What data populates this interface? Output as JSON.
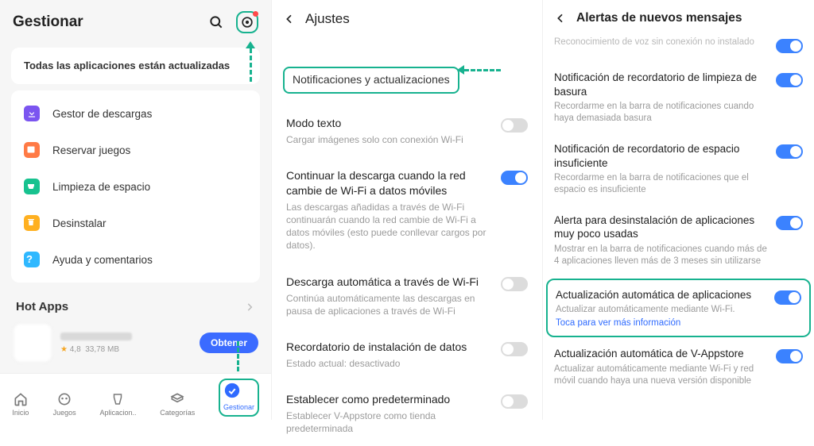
{
  "colors": {
    "accent": "#3b6bff",
    "outline": "#17b28f"
  },
  "paneA": {
    "title": "Gestionar",
    "update_card": "Todas las aplicaciones están actualizadas",
    "menu": [
      {
        "icon": "download",
        "color": "#7b55f0",
        "label": "Gestor de descargas"
      },
      {
        "icon": "calendar",
        "color": "#ff7a45",
        "label": "Reservar juegos"
      },
      {
        "icon": "broom",
        "color": "#17c28f",
        "label": "Limpieza de espacio"
      },
      {
        "icon": "trash",
        "color": "#ffb020",
        "label": "Desinstalar"
      },
      {
        "icon": "help",
        "color": "#2fb8ff",
        "label": "Ayuda y comentarios"
      }
    ],
    "hotapps_title": "Hot Apps",
    "app": {
      "rating": "4,8",
      "size": "33,78 MB",
      "get": "Obtener"
    },
    "nav": [
      {
        "icon": "home",
        "label": "Inicio"
      },
      {
        "icon": "games",
        "label": "Juegos"
      },
      {
        "icon": "apps",
        "label": "Aplicacion.."
      },
      {
        "icon": "cats",
        "label": "Categorías"
      },
      {
        "icon": "manage",
        "label": "Gestionar"
      }
    ]
  },
  "paneB": {
    "title": "Ajustes",
    "section_link": "Notificaciones y actualizaciones",
    "items": [
      {
        "title": "Modo texto",
        "sub": "Cargar imágenes solo con conexión Wi-Fi",
        "on": false
      },
      {
        "title": "Continuar la descarga cuando la red cambie de Wi-Fi a datos móviles",
        "sub": "Las descargas añadidas a través de Wi-Fi continuarán cuando la red cambie de Wi-Fi a datos móviles (esto puede conllevar cargos por datos).",
        "on": true
      },
      {
        "title": "Descarga automática a través de Wi-Fi",
        "sub": "Continúa automáticamente las descargas en pausa de aplicaciones a través de Wi-Fi",
        "on": false
      },
      {
        "title": "Recordatorio de instalación de datos",
        "sub": "Estado actual: desactivado",
        "on": false
      },
      {
        "title": "Establecer como predeterminado",
        "sub": "Establecer V-Appstore como tienda predeterminada",
        "on": false
      }
    ]
  },
  "paneC": {
    "title": "Alertas de nuevos mensajes",
    "items": [
      {
        "title": "",
        "sub": "Reconocimiento de voz sin conexión no instalado",
        "on": true,
        "first": true
      },
      {
        "title": "Notificación de recordatorio de limpieza de basura",
        "sub": "Recordarme en la barra de notificaciones cuando haya demasiada basura",
        "on": true
      },
      {
        "title": "Notificación de recordatorio de espacio insuficiente",
        "sub": "Recordarme en la barra de notificaciones que el espacio es insuficiente",
        "on": true
      },
      {
        "title": "Alerta para desinstalación de aplicaciones muy poco usadas",
        "sub": "Mostrar en la barra de notificaciones cuando más de 4 aplicaciones lleven más de 3 meses sin utilizarse",
        "on": true
      },
      {
        "title": "Actualización automática de aplicaciones",
        "sub": "Actualizar automáticamente mediante Wi-Fi.",
        "link": "Toca para ver más información",
        "on": true,
        "hl": true
      },
      {
        "title": "Actualización automática de V-Appstore",
        "sub": "Actualizar automáticamente mediante Wi-Fi y red móvil cuando haya una nueva versión disponible",
        "on": true
      }
    ]
  }
}
